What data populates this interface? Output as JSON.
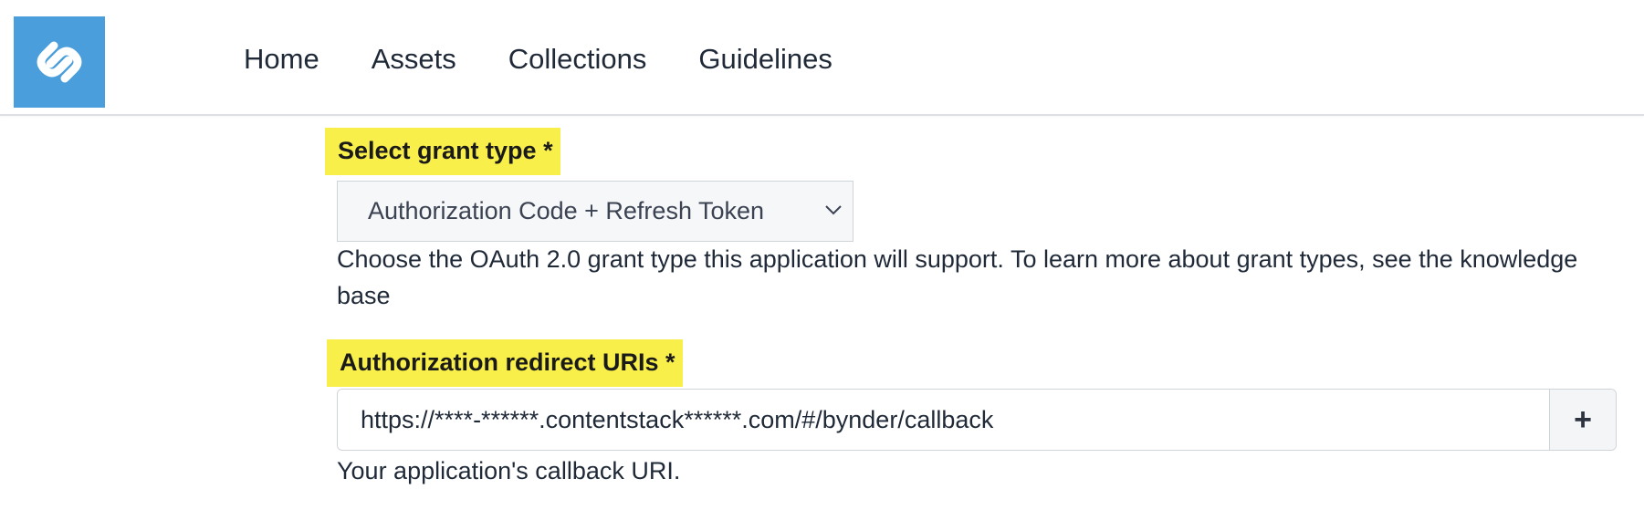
{
  "nav": {
    "items": [
      {
        "label": "Home"
      },
      {
        "label": "Assets"
      },
      {
        "label": "Collections"
      },
      {
        "label": "Guidelines"
      }
    ]
  },
  "brand": {
    "logo_icon": "bynder-logo-icon",
    "color": "#4a9edb"
  },
  "grant": {
    "label": "Select grant type *",
    "selected": "Authorization Code + Refresh Token",
    "help": "Choose the OAuth 2.0 grant type this application will support. To learn more about grant types, see the knowledge base"
  },
  "redirect": {
    "label": "Authorization redirect URIs *",
    "value": "https://****-******.contentstack******.com/#/bynder/callback",
    "add_label": "+",
    "help": "Your application's callback URI."
  },
  "colors": {
    "highlight": "#f9ef4a",
    "border": "#cfd4d9"
  }
}
